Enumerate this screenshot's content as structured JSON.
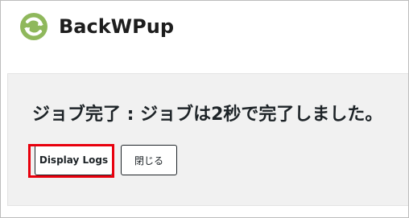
{
  "header": {
    "brand": "BackWPup",
    "logo_icon": "backwpup-logo-icon",
    "logo_color": "#8fb85c"
  },
  "dialog": {
    "title": "ジョブ完了 : ジョブは2秒で完了しました。",
    "display_logs_label": "Display Logs",
    "close_label": "閉じる"
  },
  "highlight": {
    "color": "#e8000d",
    "target": "display-logs-button"
  }
}
